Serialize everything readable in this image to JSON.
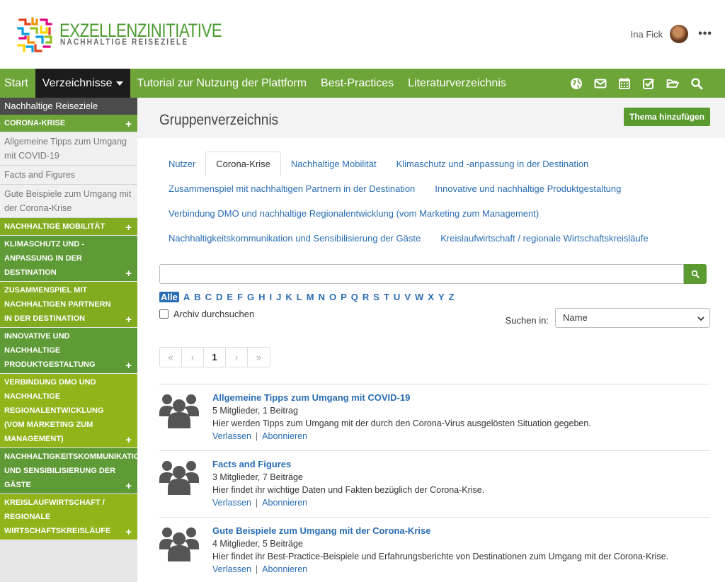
{
  "header": {
    "logo_title": "EXZELLENZINITIATIVE",
    "logo_subtitle": "NACHHALTIGE REISEZIELE",
    "user_name": "Ina Fick",
    "more_label": "•••"
  },
  "nav": {
    "items": [
      {
        "label": "Start"
      },
      {
        "label": "Verzeichnisse"
      },
      {
        "label": "Tutorial zur Nutzung der Plattform"
      },
      {
        "label": "Best-Practices"
      },
      {
        "label": "Literaturverzeichnis"
      }
    ],
    "icons": [
      "globe-icon",
      "envelope-icon",
      "calendar-icon",
      "checkbox-icon",
      "folder-open-icon",
      "search-icon"
    ]
  },
  "sidebar": {
    "title": "Nachhaltige Reiseziele",
    "corona": {
      "label": "CORONA-KRISE",
      "links": [
        "Allgemeine Tipps zum Umgang mit COVID-19",
        "Facts and Figures",
        "Gute Beispiele zum Umgang mit der Corona-Krise"
      ]
    },
    "categories": [
      "NACHHALTIGE MOBILITÄT",
      "KLIMASCHUTZ UND -ANPASSUNG IN DER DESTINATION",
      "ZUSAMMENSPIEL MIT NACHHALTIGEN PARTNERN IN DER DESTINATION",
      "INNOVATIVE UND NACHHALTIGE PRODUKTGESTALTUNG",
      "VERBINDUNG DMO UND NACHHALTIGE REGIONALENTWICKLUNG (VOM MARKETING ZUM MANAGEMENT)",
      "NACHHALTIGKEITSKOMMUNIKATION UND SENSIBILISIERUNG DER GÄSTE",
      "KREISLAUFWIRTSCHAFT / REGIONALE WIRTSCHAFTSKREISLÄUFE"
    ],
    "plus": "+"
  },
  "main": {
    "title": "Gruppenverzeichnis",
    "add_button": "Thema hinzufügen",
    "tabs": {
      "row1": [
        "Nutzer",
        "Corona-Krise",
        "Nachhaltige Mobilität",
        "Klimaschutz und -anpassung in der Destination"
      ],
      "row2": [
        "Zusammenspiel mit nachhaltigen Partnern in der Destination",
        "Innovative und nachhaltige Produktgestaltung"
      ],
      "row3": [
        "Verbindung DMO und nachhaltige Regionalentwicklung (vom Marketing zum Management)"
      ],
      "row4": [
        "Nachhaltigkeitskommunikation und Sensibilisierung der Gäste",
        "Kreislaufwirtschaft / regionale Wirtschaftskreisläufe"
      ]
    },
    "search_value": "",
    "alphabet": [
      "Alle",
      "A",
      "B",
      "C",
      "D",
      "E",
      "F",
      "G",
      "H",
      "I",
      "J",
      "K",
      "L",
      "M",
      "N",
      "O",
      "P",
      "Q",
      "R",
      "S",
      "T",
      "U",
      "V",
      "W",
      "X",
      "Y",
      "Z"
    ],
    "archive_label": "Archiv durchsuchen",
    "search_in_label": "Suchen in:",
    "search_in_value": "Name",
    "pager": [
      "«",
      "‹",
      "1",
      "›",
      "»"
    ],
    "groups": [
      {
        "title": "Allgemeine Tipps zum Umgang mit COVID-19",
        "meta": "5 Mitglieder, 1 Beitrag",
        "desc": "Hier werden Tipps zum Umgang mit der durch den Corona-Virus ausgelösten Situation gegeben.",
        "leave": "Verlassen",
        "subscribe": "Abonnieren"
      },
      {
        "title": "Facts and Figures",
        "meta": "3 Mitglieder, 7 Beiträge",
        "desc": "Hier findet ihr wichtige Daten und Fakten bezüglich der Corona-Krise.",
        "leave": "Verlassen",
        "subscribe": "Abonnieren"
      },
      {
        "title": "Gute Beispiele zum Umgang mit der Corona-Krise",
        "meta": "4 Mitglieder, 5 Beiträge",
        "desc": "Hier findet ihr Best-Practice-Beispiele und Erfahrungsberichte von Destinationen zum Umgang mit der Corona-Krise.",
        "leave": "Verlassen",
        "subscribe": "Abonnieren"
      }
    ],
    "separator": "|"
  },
  "colors": {
    "nav_green": "#6ea539",
    "button_green": "#5a9a2e",
    "link_blue": "#2a6db3",
    "sidebar_greens": [
      "#6ea539",
      "#6ea539",
      "#5e9a35",
      "#5e9a35",
      "#82ab1f",
      "#82ab1f",
      "#90b41a",
      "#5e9a35",
      "#90b41a"
    ]
  }
}
